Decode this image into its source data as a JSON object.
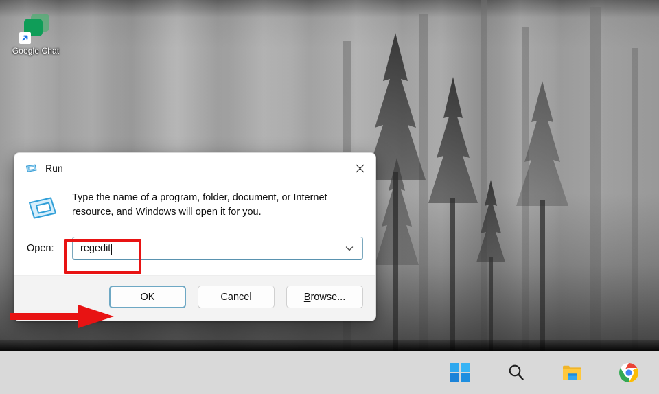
{
  "desktop": {
    "icons": [
      {
        "label": "Google Chat",
        "icon": "google-chat-icon",
        "shortcut_badge": "shortcut-arrow-icon"
      }
    ],
    "wallpaper_description": "grayscale misty pine forest"
  },
  "taskbar": {
    "items": [
      {
        "name": "start-button",
        "icon": "windows-logo-icon",
        "label": "Start"
      },
      {
        "name": "search-button",
        "icon": "search-icon",
        "label": "Search"
      },
      {
        "name": "file-explorer-button",
        "icon": "folder-icon",
        "label": "File Explorer"
      },
      {
        "name": "chrome-button",
        "icon": "chrome-icon",
        "label": "Google Chrome"
      }
    ],
    "background_color": "#d9d9d9"
  },
  "run_dialog": {
    "title": "Run",
    "title_icon": "run-icon",
    "close_label": "✕",
    "body_icon": "run-large-icon",
    "description": "Type the name of a program, folder, document, or Internet resource, and Windows will open it for you.",
    "open_label_prefix": "",
    "open_label_accel": "O",
    "open_label_suffix": "pen:",
    "input": {
      "value": "regedit",
      "placeholder": "",
      "dropdown_icon": "chevron-down-icon",
      "border_color": "#7aa7bd"
    },
    "buttons": [
      {
        "name": "ok-button",
        "label": "OK",
        "accel": "",
        "default": true
      },
      {
        "name": "cancel-button",
        "label": "Cancel",
        "accel": "",
        "default": false
      },
      {
        "name": "browse-button",
        "label": "rowse...",
        "accel": "B",
        "default": false
      }
    ]
  },
  "annotations": {
    "color": "#e81313",
    "input_highlight": "red-rectangle-around-open-input",
    "arrow": "red-arrow-pointing-at-ok-button"
  }
}
